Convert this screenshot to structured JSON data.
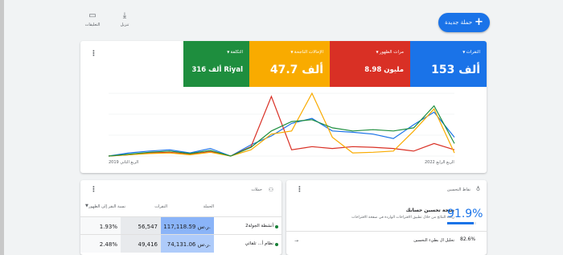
{
  "toolbar": {
    "new_campaign_label": "حملة جديدة",
    "download_label": "تنزيل",
    "notes_label": "التعليقات"
  },
  "metrics": [
    {
      "label": "النقرات",
      "value": "153 ألف",
      "color": "#1a73e8"
    },
    {
      "label": "مرات الظهور",
      "value": "8.98 مليون",
      "color": "#d93025"
    },
    {
      "label": "الإحالات الناجحة",
      "value": "47.7 ألف",
      "color": "#f9ab00"
    },
    {
      "label": "التكلفة",
      "value": "316 ألف Riyal",
      "color": "#1e8e3e"
    }
  ],
  "chart_axis": {
    "start_label": "الربع الثاني 2019",
    "end_label": "الربع الرابع 2022"
  },
  "chart_data": {
    "type": "line",
    "x": [
      0,
      1,
      2,
      3,
      4,
      5,
      6,
      7,
      8,
      9,
      10,
      11,
      12,
      13,
      14,
      15,
      16,
      17,
      18,
      19,
      20
    ],
    "series": [
      {
        "color": "#1a73e8",
        "values": [
          0,
          5,
          8,
          10,
          5,
          12,
          0,
          18,
          32,
          52,
          60,
          40,
          38,
          35,
          28,
          50,
          70,
          30
        ]
      },
      {
        "color": "#d93025",
        "values": [
          0,
          2,
          5,
          6,
          3,
          7,
          0,
          15,
          95,
          10,
          15,
          12,
          15,
          14,
          12,
          8,
          20,
          10
        ]
      },
      {
        "color": "#f9ab00",
        "values": [
          0,
          2,
          4,
          5,
          2,
          6,
          0,
          10,
          35,
          40,
          100,
          30,
          5,
          6,
          8,
          40,
          75,
          5
        ]
      },
      {
        "color": "#1e8e3e",
        "values": [
          0,
          3,
          6,
          8,
          4,
          9,
          0,
          14,
          40,
          55,
          58,
          45,
          40,
          42,
          40,
          45,
          80,
          20
        ]
      }
    ],
    "ylim": [
      0,
      100
    ]
  },
  "campaigns_card": {
    "header": "حملات",
    "columns": [
      "الحملة",
      "النقرات",
      "نسبة النقر إلى الظهور"
    ],
    "rows": [
      {
        "name": "أنشطة الجولة2",
        "cost": "117,118.59 ر.س.",
        "clicks": "56,547",
        "ctr": "1.93%"
      },
      {
        "name": "نظام أ... تلقائي",
        "cost": "74,131.06 ر.س.",
        "clicks": "49,416",
        "ctr": "2.48%"
      }
    ]
  },
  "optimization_card": {
    "header": "نقاط التحسين",
    "title": "نتيجة تحسين حسابك",
    "description": "زيادة النتائج من خلال تطبيق الاقتراحات الواردة في صفحة الاقتراحات",
    "score": "91.9%",
    "score_fraction": 0.919,
    "sub_label": "تحليل ال بطيء التحسين",
    "sub_value": "82.6%"
  }
}
